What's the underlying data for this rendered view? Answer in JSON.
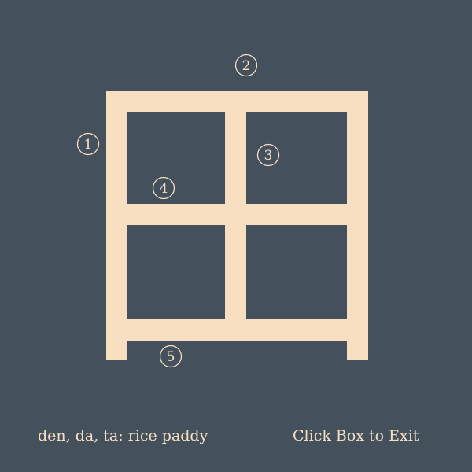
{
  "kanji": {
    "character": "田",
    "reading_meaning": "den, da, ta: rice paddy",
    "stroke_count": 5
  },
  "stroke_numbers": [
    "1",
    "2",
    "3",
    "4",
    "5"
  ],
  "controls": {
    "exit_label": "Click Box to Exit"
  },
  "colors": {
    "background": "#45505d",
    "stroke": "#f8dfc1",
    "text": "#f3dfc2"
  }
}
